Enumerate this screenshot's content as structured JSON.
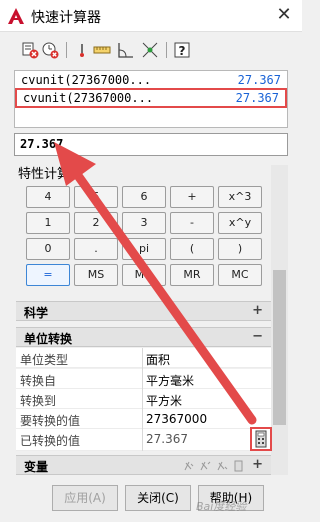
{
  "window": {
    "title": "快速计算器",
    "close_glyph": "✕"
  },
  "toolbar": {
    "icons": [
      "clear-icon",
      "clear-history-icon",
      "get-coordinates-icon",
      "distance-icon",
      "angle-icon",
      "intersection-icon",
      "help-icon"
    ]
  },
  "history": [
    {
      "expression": "cvunit(27367000...",
      "result": "27.367"
    },
    {
      "expression": "cvunit(27367000...",
      "result": "27.367"
    }
  ],
  "input": {
    "value": "27.367"
  },
  "properties_title": "特性计算",
  "keypad": {
    "rows": [
      [
        "4",
        "5",
        "6",
        "+",
        "x^3"
      ],
      [
        "1",
        "2",
        "3",
        "-",
        "x^y"
      ],
      [
        "0",
        ".",
        "pi",
        "(",
        ")"
      ],
      [
        "=",
        "MS",
        "M+",
        "MR",
        "MC"
      ]
    ]
  },
  "sections": {
    "scientific": {
      "label": "科学",
      "toggle": "+"
    },
    "units": {
      "label": "单位转换",
      "toggle": "−",
      "rows": [
        {
          "label": "单位类型",
          "value": "面积"
        },
        {
          "label": "转换自",
          "value": "平方毫米"
        },
        {
          "label": "转换到",
          "value": "平方米"
        },
        {
          "label": "要转换的值",
          "value": "27367000"
        },
        {
          "label": "已转换的值",
          "value": "27.367"
        }
      ]
    },
    "variables": {
      "label": "变量",
      "toggle": "+"
    }
  },
  "buttons": {
    "apply": "应用(A)",
    "close": "关闭(C)",
    "help": "帮助(H)"
  },
  "watermark": "Bai度经验",
  "colors": {
    "highlight": "#e34a4a",
    "result_blue": "#1a63d6",
    "brand_red": "#c8102e"
  }
}
